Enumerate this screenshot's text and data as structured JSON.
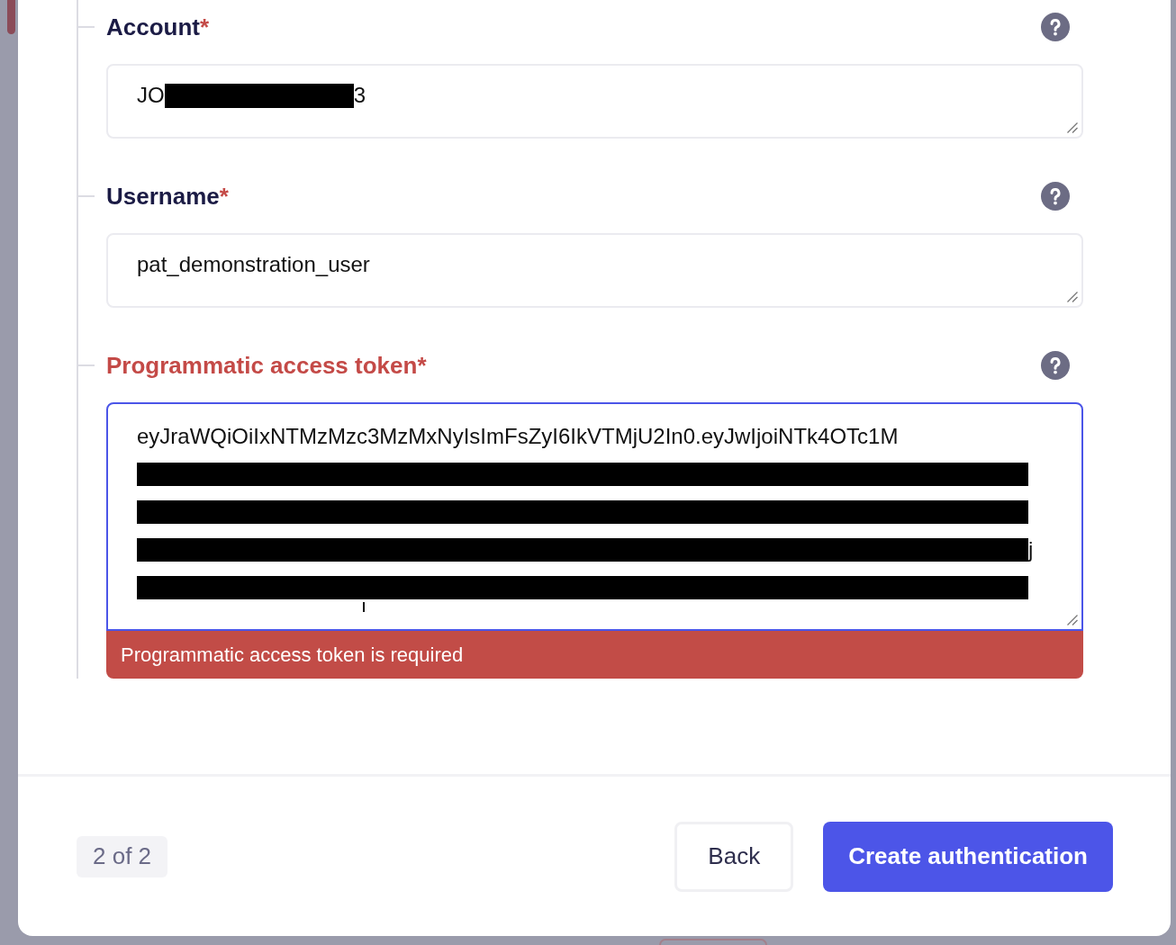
{
  "form": {
    "fields": [
      {
        "label": "Account",
        "required_mark": "*",
        "help": true,
        "invalid": false,
        "focused": false,
        "lines": [
          [
            {
              "kind": "text",
              "text": "JO"
            },
            {
              "kind": "redacted"
            },
            {
              "kind": "text",
              "text": "3"
            }
          ]
        ]
      },
      {
        "label": "Username",
        "required_mark": "*",
        "help": true,
        "invalid": false,
        "focused": false,
        "lines": [
          [
            {
              "kind": "text",
              "text": "pat_demonstration_user"
            }
          ]
        ]
      },
      {
        "label": "Programmatic access token",
        "required_mark": "*",
        "help": true,
        "invalid": true,
        "focused": true,
        "lines": [
          [
            {
              "kind": "text",
              "text": "eyJraWQiOiIxNTMzMzc3MzMxNyIsImFsZyI6IkVTMjU2In0.eyJwIjoiNTk4OTc1M"
            }
          ],
          [
            {
              "kind": "redacted"
            }
          ],
          [
            {
              "kind": "redacted"
            }
          ],
          [
            {
              "kind": "redacted"
            },
            {
              "kind": "text",
              "text": "j"
            }
          ],
          [
            {
              "kind": "redacted"
            }
          ]
        ],
        "error": "Programmatic access token is required"
      }
    ]
  },
  "footer": {
    "step": "2 of 2",
    "buttons": [
      {
        "label": "Back",
        "kind": "secondary"
      },
      {
        "label": "Create authentication",
        "kind": "primary"
      }
    ]
  }
}
